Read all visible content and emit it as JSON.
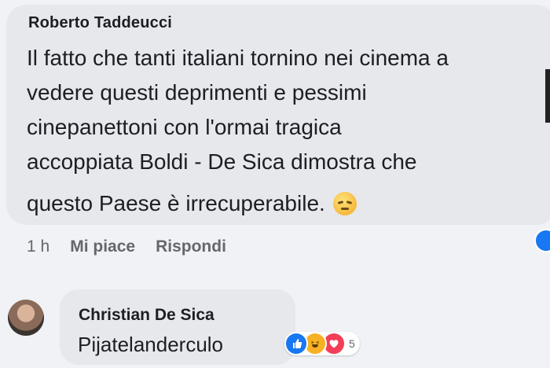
{
  "comment": {
    "author": "Roberto Taddeucci",
    "lines": [
      "Il fatto che tanti italiani tornino nei cinema a",
      "vedere questi deprimenti e pessimi",
      "cinepanettoni con l'ormai tragica",
      "accoppiata Boldi - De Sica dimostra che",
      "questo Paese è irrecuperabile."
    ],
    "emoji": "sad-face",
    "meta": {
      "time": "1 h",
      "like": "Mi piace",
      "reply": "Rispondi"
    }
  },
  "reply": {
    "author": "Christian De Sica",
    "text": "Pijatelanderculo",
    "reactions": [
      "like",
      "haha",
      "love"
    ],
    "reaction_count": "5"
  },
  "colors": {
    "like": "#1877f2",
    "haha": "#f7b125",
    "love": "#f33e58",
    "bubble": "#e6e8eb",
    "meta": "#65676b"
  }
}
